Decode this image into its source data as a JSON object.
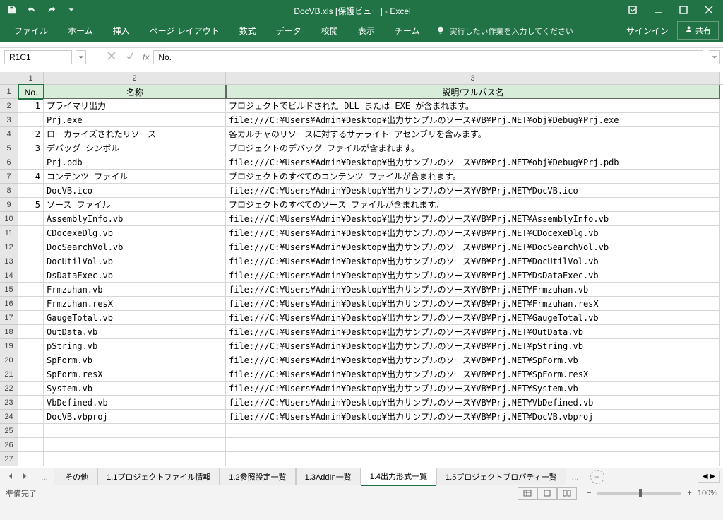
{
  "titlebar": {
    "title": "DocVB.xls  [保護ビュー] - Excel"
  },
  "ribbon": {
    "tabs": [
      "ファイル",
      "ホーム",
      "挿入",
      "ページ レイアウト",
      "数式",
      "データ",
      "校閲",
      "表示",
      "チーム"
    ],
    "tellme": "実行したい作業を入力してください",
    "signin": "サインイン",
    "share": "共有"
  },
  "formula_bar": {
    "namebox": "R1C1",
    "value": "No."
  },
  "columns": [
    "1",
    "2",
    "3"
  ],
  "header_row": {
    "c1": "No.",
    "c2": "名称",
    "c3": "説明/フルパス名"
  },
  "rows": [
    {
      "n": "1",
      "a": "1",
      "b": "プライマリ出力",
      "c": "プロジェクトでビルドされた DLL または EXE が含まれます。"
    },
    {
      "n": "2",
      "a": "",
      "b": "Prj.exe",
      "c": "file:///C:¥Users¥Admin¥Desktop¥出力サンプルのソース¥VB¥Prj.NET¥obj¥Debug¥Prj.exe"
    },
    {
      "n": "3",
      "a": "2",
      "b": "ローカライズされたリソース",
      "c": "各カルチャのリソースに対するサテライト アセンブリを含みます。"
    },
    {
      "n": "4",
      "a": "3",
      "b": "デバッグ シンボル",
      "c": "プロジェクトのデバッグ ファイルが含まれます。"
    },
    {
      "n": "5",
      "a": "",
      "b": "Prj.pdb",
      "c": "file:///C:¥Users¥Admin¥Desktop¥出力サンプルのソース¥VB¥Prj.NET¥obj¥Debug¥Prj.pdb"
    },
    {
      "n": "6",
      "a": "4",
      "b": "コンテンツ ファイル",
      "c": "プロジェクトのすべてのコンテンツ ファイルが含まれます。"
    },
    {
      "n": "7",
      "a": "",
      "b": "DocVB.ico",
      "c": "file:///C:¥Users¥Admin¥Desktop¥出力サンプルのソース¥VB¥Prj.NET¥DocVB.ico"
    },
    {
      "n": "8",
      "a": "5",
      "b": "ソース ファイル",
      "c": "プロジェクトのすべてのソース ファイルが含まれます。"
    },
    {
      "n": "9",
      "a": "",
      "b": "AssemblyInfo.vb",
      "c": "file:///C:¥Users¥Admin¥Desktop¥出力サンプルのソース¥VB¥Prj.NET¥AssemblyInfo.vb"
    },
    {
      "n": "10",
      "a": "",
      "b": "CDocexeDlg.vb",
      "c": "file:///C:¥Users¥Admin¥Desktop¥出力サンプルのソース¥VB¥Prj.NET¥CDocexeDlg.vb"
    },
    {
      "n": "11",
      "a": "",
      "b": "DocSearchVol.vb",
      "c": "file:///C:¥Users¥Admin¥Desktop¥出力サンプルのソース¥VB¥Prj.NET¥DocSearchVol.vb"
    },
    {
      "n": "12",
      "a": "",
      "b": "DocUtilVol.vb",
      "c": "file:///C:¥Users¥Admin¥Desktop¥出力サンプルのソース¥VB¥Prj.NET¥DocUtilVol.vb"
    },
    {
      "n": "13",
      "a": "",
      "b": "DsDataExec.vb",
      "c": "file:///C:¥Users¥Admin¥Desktop¥出力サンプルのソース¥VB¥Prj.NET¥DsDataExec.vb"
    },
    {
      "n": "14",
      "a": "",
      "b": "Frmzuhan.vb",
      "c": "file:///C:¥Users¥Admin¥Desktop¥出力サンプルのソース¥VB¥Prj.NET¥Frmzuhan.vb"
    },
    {
      "n": "15",
      "a": "",
      "b": "Frmzuhan.resX",
      "c": "file:///C:¥Users¥Admin¥Desktop¥出力サンプルのソース¥VB¥Prj.NET¥Frmzuhan.resX"
    },
    {
      "n": "16",
      "a": "",
      "b": "GaugeTotal.vb",
      "c": "file:///C:¥Users¥Admin¥Desktop¥出力サンプルのソース¥VB¥Prj.NET¥GaugeTotal.vb"
    },
    {
      "n": "17",
      "a": "",
      "b": "OutData.vb",
      "c": "file:///C:¥Users¥Admin¥Desktop¥出力サンプルのソース¥VB¥Prj.NET¥OutData.vb"
    },
    {
      "n": "18",
      "a": "",
      "b": "pString.vb",
      "c": "file:///C:¥Users¥Admin¥Desktop¥出力サンプルのソース¥VB¥Prj.NET¥pString.vb"
    },
    {
      "n": "19",
      "a": "",
      "b": "SpForm.vb",
      "c": "file:///C:¥Users¥Admin¥Desktop¥出力サンプルのソース¥VB¥Prj.NET¥SpForm.vb"
    },
    {
      "n": "20",
      "a": "",
      "b": "SpForm.resX",
      "c": "file:///C:¥Users¥Admin¥Desktop¥出力サンプルのソース¥VB¥Prj.NET¥SpForm.resX"
    },
    {
      "n": "21",
      "a": "",
      "b": "System.vb",
      "c": "file:///C:¥Users¥Admin¥Desktop¥出力サンプルのソース¥VB¥Prj.NET¥System.vb"
    },
    {
      "n": "22",
      "a": "",
      "b": "VbDefined.vb",
      "c": "file:///C:¥Users¥Admin¥Desktop¥出力サンプルのソース¥VB¥Prj.NET¥VbDefined.vb"
    },
    {
      "n": "23",
      "a": "",
      "b": "DocVB.vbproj",
      "c": "file:///C:¥Users¥Admin¥Desktop¥出力サンプルのソース¥VB¥Prj.NET¥DocVB.vbproj"
    },
    {
      "n": "24",
      "a": "",
      "b": "",
      "c": ""
    },
    {
      "n": "25",
      "a": "",
      "b": "",
      "c": ""
    },
    {
      "n": "26",
      "a": "",
      "b": "",
      "c": ""
    }
  ],
  "sheets": {
    "dots": "...",
    "list": [
      ".その他",
      "1.1プロジェクトファイル情報",
      "1.2参照設定一覧",
      "1.3AddIn一覧",
      "1.4出力形式一覧",
      "1.5プロジェクトプロパティ一覧"
    ],
    "active": 4
  },
  "status": {
    "ready": "準備完了",
    "zoom": "100%"
  }
}
